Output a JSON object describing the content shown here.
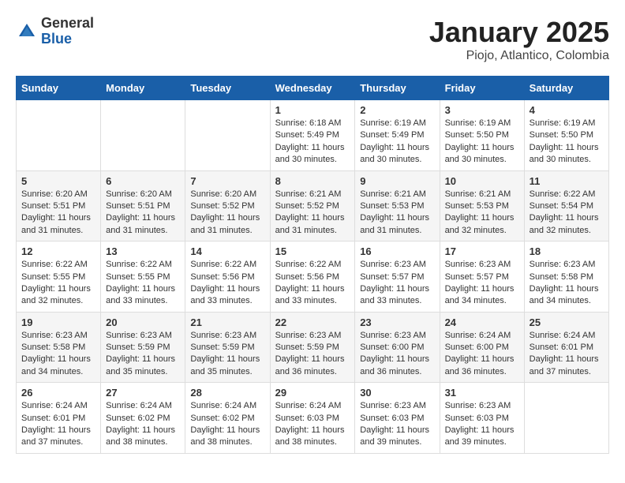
{
  "logo": {
    "general": "General",
    "blue": "Blue"
  },
  "title": "January 2025",
  "subtitle": "Piojo, Atlantico, Colombia",
  "days_of_week": [
    "Sunday",
    "Monday",
    "Tuesday",
    "Wednesday",
    "Thursday",
    "Friday",
    "Saturday"
  ],
  "weeks": [
    [
      {
        "day": "",
        "info": ""
      },
      {
        "day": "",
        "info": ""
      },
      {
        "day": "",
        "info": ""
      },
      {
        "day": "1",
        "info": "Sunrise: 6:18 AM\nSunset: 5:49 PM\nDaylight: 11 hours and 30 minutes."
      },
      {
        "day": "2",
        "info": "Sunrise: 6:19 AM\nSunset: 5:49 PM\nDaylight: 11 hours and 30 minutes."
      },
      {
        "day": "3",
        "info": "Sunrise: 6:19 AM\nSunset: 5:50 PM\nDaylight: 11 hours and 30 minutes."
      },
      {
        "day": "4",
        "info": "Sunrise: 6:19 AM\nSunset: 5:50 PM\nDaylight: 11 hours and 30 minutes."
      }
    ],
    [
      {
        "day": "5",
        "info": "Sunrise: 6:20 AM\nSunset: 5:51 PM\nDaylight: 11 hours and 31 minutes."
      },
      {
        "day": "6",
        "info": "Sunrise: 6:20 AM\nSunset: 5:51 PM\nDaylight: 11 hours and 31 minutes."
      },
      {
        "day": "7",
        "info": "Sunrise: 6:20 AM\nSunset: 5:52 PM\nDaylight: 11 hours and 31 minutes."
      },
      {
        "day": "8",
        "info": "Sunrise: 6:21 AM\nSunset: 5:52 PM\nDaylight: 11 hours and 31 minutes."
      },
      {
        "day": "9",
        "info": "Sunrise: 6:21 AM\nSunset: 5:53 PM\nDaylight: 11 hours and 31 minutes."
      },
      {
        "day": "10",
        "info": "Sunrise: 6:21 AM\nSunset: 5:53 PM\nDaylight: 11 hours and 32 minutes."
      },
      {
        "day": "11",
        "info": "Sunrise: 6:22 AM\nSunset: 5:54 PM\nDaylight: 11 hours and 32 minutes."
      }
    ],
    [
      {
        "day": "12",
        "info": "Sunrise: 6:22 AM\nSunset: 5:55 PM\nDaylight: 11 hours and 32 minutes."
      },
      {
        "day": "13",
        "info": "Sunrise: 6:22 AM\nSunset: 5:55 PM\nDaylight: 11 hours and 33 minutes."
      },
      {
        "day": "14",
        "info": "Sunrise: 6:22 AM\nSunset: 5:56 PM\nDaylight: 11 hours and 33 minutes."
      },
      {
        "day": "15",
        "info": "Sunrise: 6:22 AM\nSunset: 5:56 PM\nDaylight: 11 hours and 33 minutes."
      },
      {
        "day": "16",
        "info": "Sunrise: 6:23 AM\nSunset: 5:57 PM\nDaylight: 11 hours and 33 minutes."
      },
      {
        "day": "17",
        "info": "Sunrise: 6:23 AM\nSunset: 5:57 PM\nDaylight: 11 hours and 34 minutes."
      },
      {
        "day": "18",
        "info": "Sunrise: 6:23 AM\nSunset: 5:58 PM\nDaylight: 11 hours and 34 minutes."
      }
    ],
    [
      {
        "day": "19",
        "info": "Sunrise: 6:23 AM\nSunset: 5:58 PM\nDaylight: 11 hours and 34 minutes."
      },
      {
        "day": "20",
        "info": "Sunrise: 6:23 AM\nSunset: 5:59 PM\nDaylight: 11 hours and 35 minutes."
      },
      {
        "day": "21",
        "info": "Sunrise: 6:23 AM\nSunset: 5:59 PM\nDaylight: 11 hours and 35 minutes."
      },
      {
        "day": "22",
        "info": "Sunrise: 6:23 AM\nSunset: 5:59 PM\nDaylight: 11 hours and 36 minutes."
      },
      {
        "day": "23",
        "info": "Sunrise: 6:23 AM\nSunset: 6:00 PM\nDaylight: 11 hours and 36 minutes."
      },
      {
        "day": "24",
        "info": "Sunrise: 6:24 AM\nSunset: 6:00 PM\nDaylight: 11 hours and 36 minutes."
      },
      {
        "day": "25",
        "info": "Sunrise: 6:24 AM\nSunset: 6:01 PM\nDaylight: 11 hours and 37 minutes."
      }
    ],
    [
      {
        "day": "26",
        "info": "Sunrise: 6:24 AM\nSunset: 6:01 PM\nDaylight: 11 hours and 37 minutes."
      },
      {
        "day": "27",
        "info": "Sunrise: 6:24 AM\nSunset: 6:02 PM\nDaylight: 11 hours and 38 minutes."
      },
      {
        "day": "28",
        "info": "Sunrise: 6:24 AM\nSunset: 6:02 PM\nDaylight: 11 hours and 38 minutes."
      },
      {
        "day": "29",
        "info": "Sunrise: 6:24 AM\nSunset: 6:03 PM\nDaylight: 11 hours and 38 minutes."
      },
      {
        "day": "30",
        "info": "Sunrise: 6:23 AM\nSunset: 6:03 PM\nDaylight: 11 hours and 39 minutes."
      },
      {
        "day": "31",
        "info": "Sunrise: 6:23 AM\nSunset: 6:03 PM\nDaylight: 11 hours and 39 minutes."
      },
      {
        "day": "",
        "info": ""
      }
    ]
  ]
}
